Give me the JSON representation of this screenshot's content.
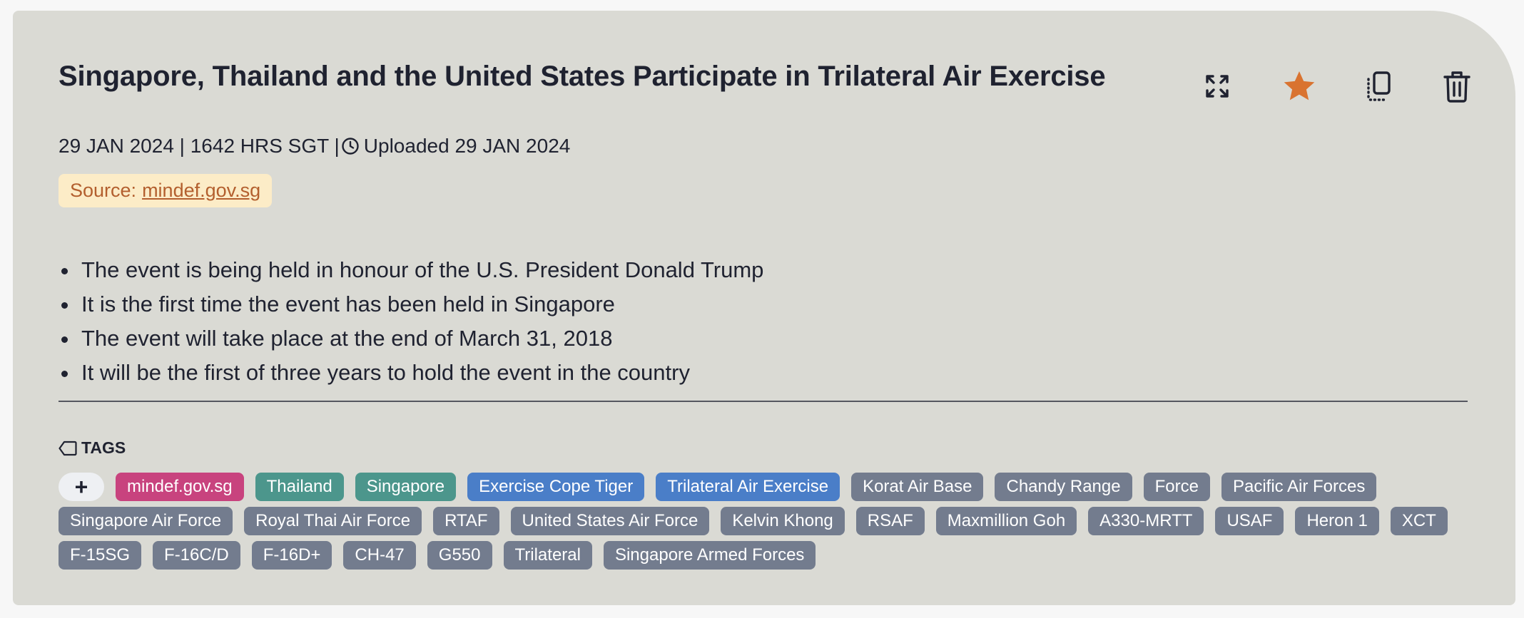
{
  "article": {
    "title": "Singapore, Thailand and the United States Participate in Trilateral Air Exercise",
    "date": "29 JAN 2024 | 1642 HRS SGT |",
    "uploaded": "Uploaded 29 JAN 2024",
    "source_label": "Source:",
    "source_link": "mindef.gov.sg",
    "bullets": [
      "The event is being held in honour of the U.S. President Donald Trump",
      "It is the first time the event has been held in Singapore",
      "The event will take place at the end of March 31, 2018",
      "It will be the first of three years to hold the event in the country"
    ]
  },
  "actions": {
    "icons": [
      "expand-icon",
      "star-icon",
      "copy-icon",
      "trash-icon"
    ],
    "star_color": "#d97330"
  },
  "tags": {
    "heading": "TAGS",
    "add_label": "+",
    "items": [
      {
        "label": "mindef.gov.sg",
        "color": "#c8437e"
      },
      {
        "label": "Thailand",
        "color": "#4c968c"
      },
      {
        "label": "Singapore",
        "color": "#4c968c"
      },
      {
        "label": "Exercise Cope Tiger",
        "color": "#4a7ec8"
      },
      {
        "label": "Trilateral Air Exercise",
        "color": "#4a7ec8"
      },
      {
        "label": "Korat Air Base",
        "color": "#737c8e"
      },
      {
        "label": "Chandy Range",
        "color": "#737c8e"
      },
      {
        "label": "Force",
        "color": "#737c8e"
      },
      {
        "label": "Pacific Air Forces",
        "color": "#737c8e"
      },
      {
        "label": "Singapore Air Force",
        "color": "#737c8e"
      },
      {
        "label": "Royal Thai Air Force",
        "color": "#737c8e"
      },
      {
        "label": "RTAF",
        "color": "#737c8e"
      },
      {
        "label": "United States Air Force",
        "color": "#737c8e"
      },
      {
        "label": "Kelvin Khong",
        "color": "#737c8e"
      },
      {
        "label": "RSAF",
        "color": "#737c8e"
      },
      {
        "label": "Maxmillion Goh",
        "color": "#737c8e"
      },
      {
        "label": "A330-MRTT",
        "color": "#737c8e"
      },
      {
        "label": "USAF",
        "color": "#737c8e"
      },
      {
        "label": "Heron 1",
        "color": "#737c8e"
      },
      {
        "label": "XCT",
        "color": "#737c8e"
      },
      {
        "label": "F-15SG",
        "color": "#737c8e"
      },
      {
        "label": "F-16C/D",
        "color": "#737c8e"
      },
      {
        "label": "F-16D+",
        "color": "#737c8e"
      },
      {
        "label": "CH-47",
        "color": "#737c8e"
      },
      {
        "label": "G550",
        "color": "#737c8e"
      },
      {
        "label": "Trilateral",
        "color": "#737c8e"
      },
      {
        "label": "Singapore Armed Forces",
        "color": "#737c8e"
      }
    ]
  }
}
